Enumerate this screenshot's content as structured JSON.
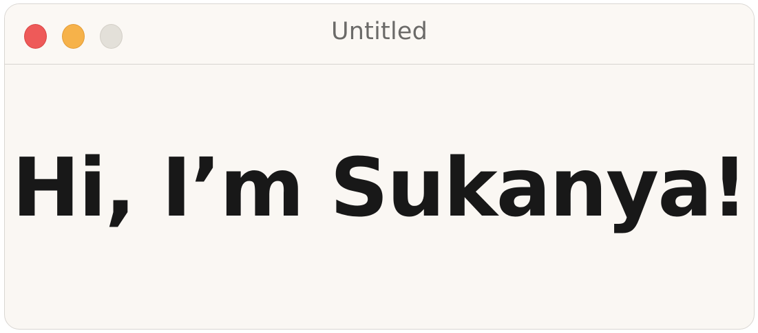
{
  "window": {
    "title": "Untitled",
    "controls": {
      "close": {
        "icon": "close-icon",
        "color": "#ee5a59"
      },
      "minimize": {
        "icon": "minimize-icon",
        "color": "#f6b24a"
      },
      "zoom": {
        "icon": "zoom-icon",
        "color": "#e3e0d9"
      }
    }
  },
  "content": {
    "greeting": "Hi, I’m Sukanya!"
  }
}
